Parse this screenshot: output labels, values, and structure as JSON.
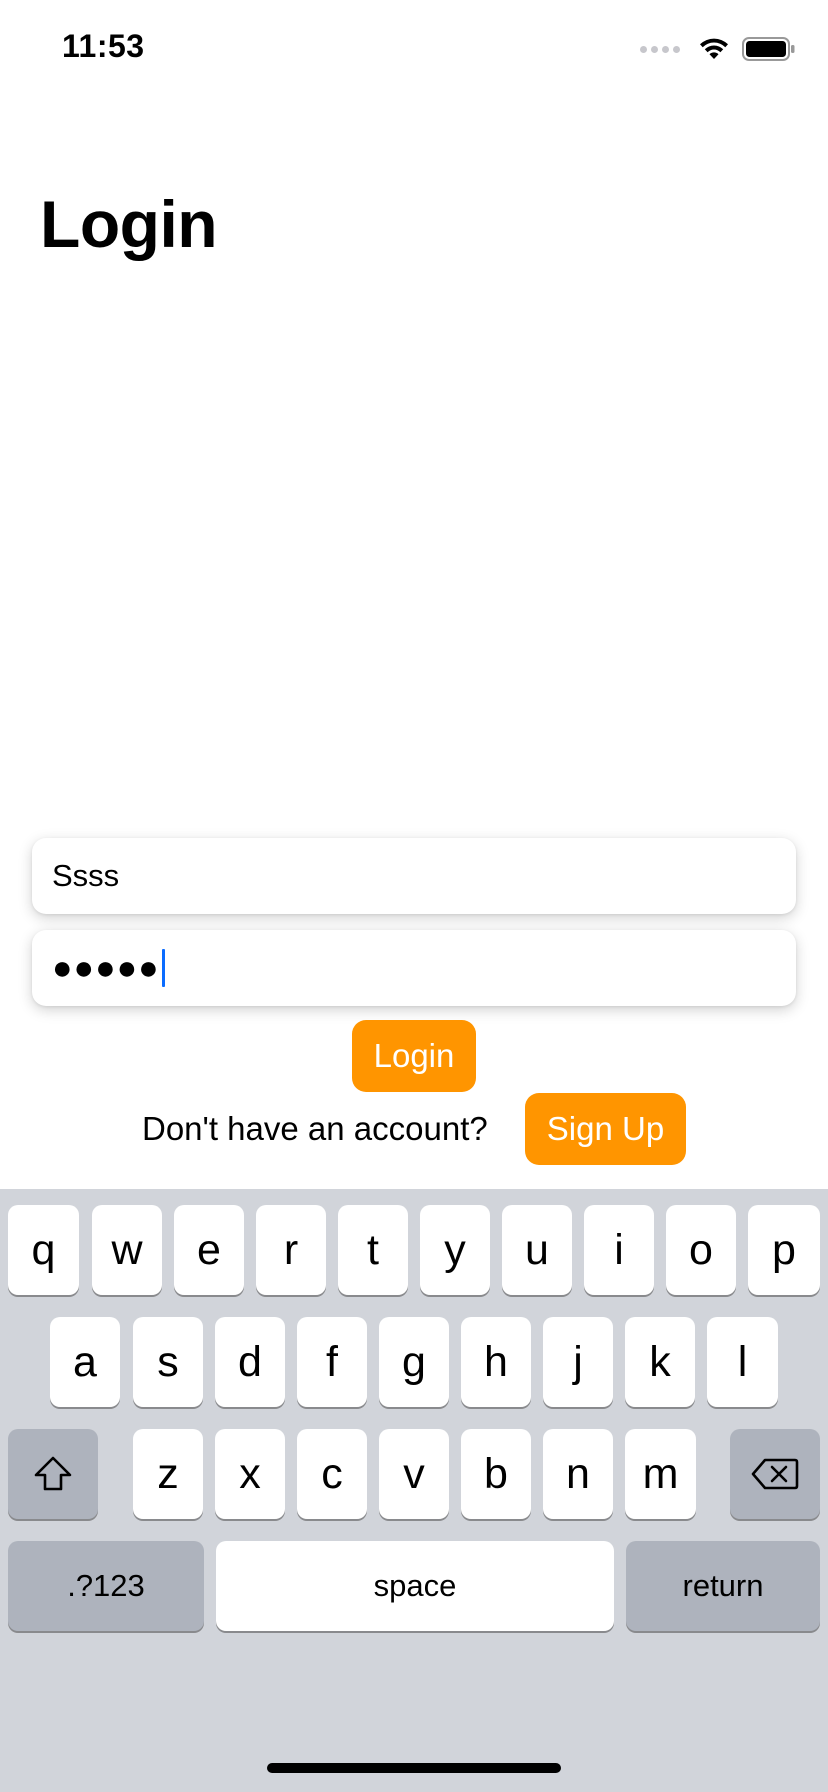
{
  "status_bar": {
    "time": "11:53"
  },
  "page": {
    "title": "Login"
  },
  "form": {
    "username_value": "Ssss",
    "password_value": "●●●●●",
    "login_label": "Login",
    "signup_prompt": "Don't have an account?",
    "signup_label": "Sign Up"
  },
  "keyboard": {
    "row1": [
      "q",
      "w",
      "e",
      "r",
      "t",
      "y",
      "u",
      "i",
      "o",
      "p"
    ],
    "row2": [
      "a",
      "s",
      "d",
      "f",
      "g",
      "h",
      "j",
      "k",
      "l"
    ],
    "row3": [
      "z",
      "x",
      "c",
      "v",
      "b",
      "n",
      "m"
    ],
    "numbers_label": ".?123",
    "space_label": "space",
    "return_label": "return",
    "shift_icon": "shift-icon",
    "delete_icon": "backspace-icon"
  },
  "colors": {
    "accent": "#ff9500",
    "caret": "#0a6cff",
    "keyboard_bg": "#d1d4da"
  }
}
